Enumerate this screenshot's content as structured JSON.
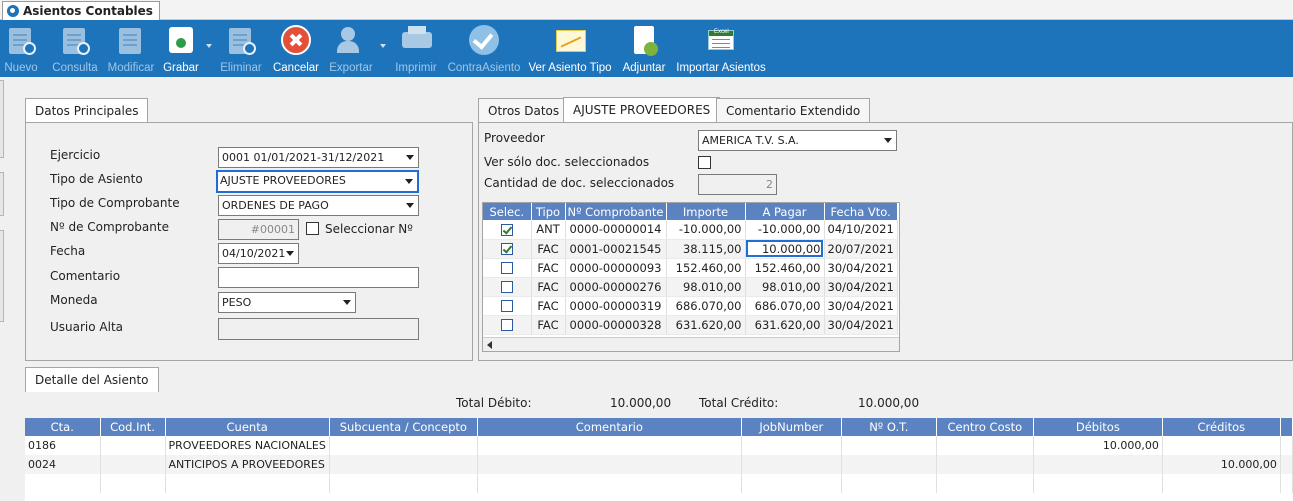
{
  "window_tab": {
    "label": "Asientos Contables"
  },
  "toolbar": {
    "nuevo": "Nuevo",
    "consulta": "Consulta",
    "modificar": "Modificar",
    "grabar": "Grabar",
    "eliminar": "Eliminar",
    "cancelar": "Cancelar",
    "exportar": "Exportar",
    "imprimir": "Imprimir",
    "contra_asiento": "ContraAsiento",
    "ver_asiento_tipo": "Ver Asiento Tipo",
    "adjuntar": "Adjuntar",
    "importar_asientos": "Importar Asientos",
    "excel_badge": "Excel"
  },
  "datos_principales": {
    "tab": "Datos Principales",
    "ejercicio_label": "Ejercicio",
    "ejercicio_value": "0001 01/01/2021-31/12/2021",
    "tipo_asiento_label": "Tipo de Asiento",
    "tipo_asiento_value": "AJUSTE PROVEEDORES",
    "tipo_comprobante_label": "Tipo de Comprobante",
    "tipo_comprobante_value": "ORDENES DE PAGO",
    "nro_comprobante_label": "Nº de Comprobante",
    "nro_comprobante_value": "#00001",
    "seleccionar_label": "Seleccionar Nº",
    "fecha_label": "Fecha",
    "fecha_value": "04/10/2021",
    "comentario_label": "Comentario",
    "comentario_value": "",
    "moneda_label": "Moneda",
    "moneda_value": "PESO",
    "usuario_alta_label": "Usuario Alta",
    "usuario_alta_value": ""
  },
  "right_panel": {
    "tabs": [
      "Otros Datos",
      "AJUSTE PROVEEDORES",
      "Comentario Extendido"
    ],
    "proveedor_label": "Proveedor",
    "proveedor_value": "AMERICA T.V. S.A.",
    "ver_solo_label": "Ver sólo doc. seleccionados",
    "cantidad_label": "Cantidad de doc. seleccionados",
    "cantidad_value": "2",
    "columns": [
      "Selec.",
      "Tipo",
      "Nº Comprobante",
      "Importe",
      "A Pagar",
      "Fecha Vto."
    ],
    "rows": [
      {
        "selected": true,
        "tipo": "ANT",
        "comprobante": "0000-00000014",
        "importe": "-10.000,00",
        "a_pagar": "-10.000,00",
        "fecha": "04/10/2021"
      },
      {
        "selected": true,
        "tipo": "FAC",
        "comprobante": "0001-00021545",
        "importe": "38.115,00",
        "a_pagar": "10.000,00",
        "fecha": "20/07/2021"
      },
      {
        "selected": false,
        "tipo": "FAC",
        "comprobante": "0000-00000093",
        "importe": "152.460,00",
        "a_pagar": "152.460,00",
        "fecha": "30/04/2021"
      },
      {
        "selected": false,
        "tipo": "FAC",
        "comprobante": "0000-00000276",
        "importe": "98.010,00",
        "a_pagar": "98.010,00",
        "fecha": "30/04/2021"
      },
      {
        "selected": false,
        "tipo": "FAC",
        "comprobante": "0000-00000319",
        "importe": "686.070,00",
        "a_pagar": "686.070,00",
        "fecha": "30/04/2021"
      },
      {
        "selected": false,
        "tipo": "FAC",
        "comprobante": "0000-00000328",
        "importe": "631.620,00",
        "a_pagar": "631.620,00",
        "fecha": "30/04/2021"
      }
    ]
  },
  "detalle": {
    "tab": "Detalle del Asiento",
    "total_debito_label": "Total Débito:",
    "total_debito_value": "10.000,00",
    "total_credito_label": "Total Crédito:",
    "total_credito_value": "10.000,00",
    "columns": [
      "Cta.",
      "Cod.Int.",
      "Cuenta",
      "Subcuenta / Concepto",
      "Comentario",
      "JobNumber",
      "Nº O.T.",
      "Centro Costo",
      "Débitos",
      "Créditos"
    ],
    "rows": [
      {
        "cta": "0186",
        "cod_int": "",
        "cuenta": "PROVEEDORES NACIONALES",
        "subcuenta": "",
        "comentario": "",
        "jobnumber": "",
        "ot": "",
        "centro_costo": "",
        "debitos": "10.000,00",
        "creditos": ""
      },
      {
        "cta": "0024",
        "cod_int": "",
        "cuenta": "ANTICIPOS A PROVEEDORES",
        "subcuenta": "",
        "comentario": "",
        "jobnumber": "",
        "ot": "",
        "centro_costo": "",
        "debitos": "",
        "creditos": "10.000,00"
      }
    ]
  }
}
